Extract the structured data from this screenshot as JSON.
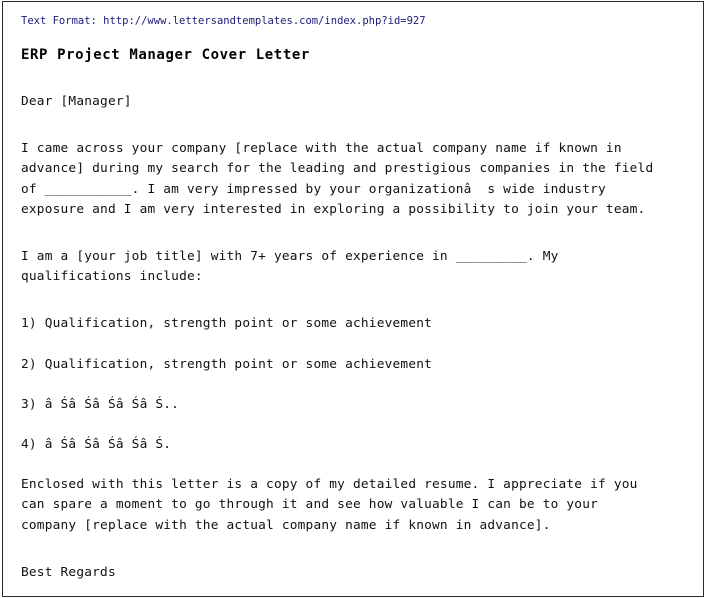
{
  "document": {
    "source_label": "Text Format: http://www.lettersandtemplates.com/index.php?id=927",
    "title": "ERP Project Manager Cover Letter",
    "salutation": "Dear [Manager]",
    "paragraphs": {
      "intro": "I came across your company [replace with the actual company name if known in\nadvance] during my search for the leading and prestigious companies in the field\nof ___________. I am very impressed by your organizationâ  s wide industry\nexposure and I am very interested in exploring a possibility to join your team.",
      "experience": "I am a [your job title] with 7+ years of experience in _________. My\nqualifications include:",
      "closing": "Enclosed with this letter is a copy of my detailed resume. I appreciate if you\ncan spare a moment to go through it and see how valuable I can be to your\ncompany [replace with the actual company name if known in advance]."
    },
    "qualifications": [
      "1) Qualification, strength point or some achievement",
      "2) Qualification, strength point or some achievement",
      "3) â Śâ Śâ Śâ Śâ Ś..",
      "4) â Śâ Śâ Śâ Śâ Ś."
    ],
    "signoff": "Best Regards"
  },
  "colors": {
    "page_background": "#ffffff",
    "border": "#2b2b2b",
    "source_link_text": "#1c1c7a",
    "body_text": "#111111",
    "title_text": "#000000"
  }
}
